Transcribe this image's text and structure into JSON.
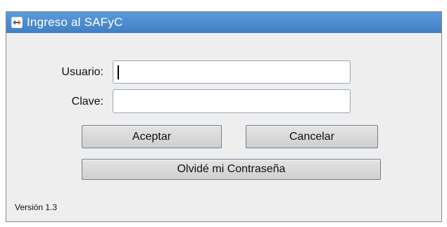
{
  "window": {
    "title": "Ingreso al SAFyC",
    "title_icon": "app-arrows-icon",
    "titlebar_color": "#4a8bd0"
  },
  "form": {
    "username_label": "Usuario:",
    "username_value": "",
    "password_label": "Clave:",
    "password_value": ""
  },
  "buttons": {
    "accept_label": "Aceptar",
    "cancel_label": "Cancelar",
    "forgot_label": "Olvidé mi Contraseña"
  },
  "footer": {
    "version": "Versión 1.3"
  }
}
